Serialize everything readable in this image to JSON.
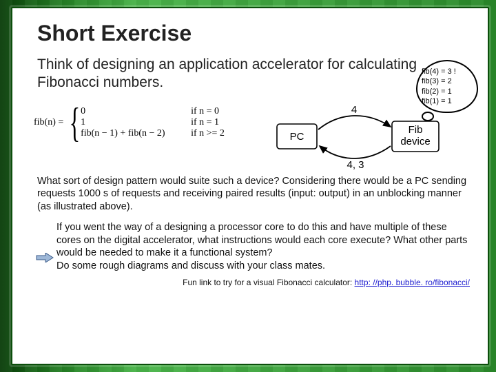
{
  "title": "Short Exercise",
  "intro": "Think of designing an application accelerator for calculating Fibonacci numbers.",
  "thought": {
    "l1": "fib(4) = 3 !",
    "l2": "fib(3) = 2",
    "l3": "fib(2) = 1",
    "l4": "fib(1) = 1"
  },
  "formula": {
    "lhs": "fib(n) =",
    "cases": [
      {
        "expr": "0",
        "cond": "if n = 0"
      },
      {
        "expr": "1",
        "cond": "if n = 1"
      },
      {
        "expr": "fib(n − 1) + fib(n − 2)",
        "cond": "if n >= 2"
      }
    ]
  },
  "diagram": {
    "pc": "PC",
    "fib1": "Fib",
    "fib2": "device",
    "top_arrow": "4",
    "bottom_arrow": "4, 3"
  },
  "para1": "What sort of design pattern would suite such a device? Considering there would be a PC sending requests 1000 s of requests and receiving paired results (input: output) in an unblocking manner (as illustrated above).",
  "para2": "If you went the way of a designing a processor core to do this and have multiple of these cores on the digital accelerator, what instructions would each core execute? What other parts would be needed to make it a functional system?\nDo some rough diagrams and discuss with your class mates.",
  "footer": {
    "prefix": "Fun link to try for a visual Fibonacci calculator: ",
    "url_text": "http: //php. bubble. ro/fibonacci/"
  }
}
